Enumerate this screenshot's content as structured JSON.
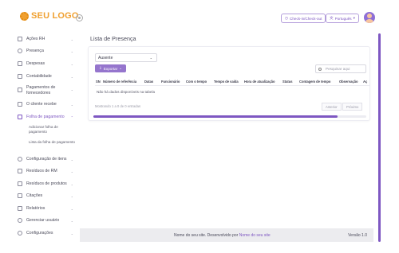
{
  "header": {
    "logo_text": "SEU LOGO",
    "checkin_label": "Check-in/Check-out",
    "language_label": "Português"
  },
  "sidebar": {
    "items": [
      {
        "label": "Ações RH"
      },
      {
        "label": "Presença"
      },
      {
        "label": "Despesas"
      },
      {
        "label": "Contabilidade"
      },
      {
        "label": "Pagamentos de fornecedores"
      },
      {
        "label": "O cliente recebe"
      },
      {
        "label": "Folha de pagamento"
      },
      {
        "label": "Configuração de itens"
      },
      {
        "label": "Resíduos de RM"
      },
      {
        "label": "Resíduos de produtos"
      },
      {
        "label": "Citações"
      },
      {
        "label": "Relatórios"
      },
      {
        "label": "Gerenciar usuário"
      },
      {
        "label": "Configurações"
      }
    ],
    "subitems": [
      {
        "label": "Adicionar folha de pagamento"
      },
      {
        "label": "Lista da folha de pagamento"
      }
    ]
  },
  "main": {
    "page_title": "Lista de Presença",
    "filter_value": "Ausente",
    "export_label": "Exportar",
    "search_placeholder": "Pesquisar aqui",
    "columns": [
      "SN",
      "Número de referência",
      "Datas",
      "Funcionário",
      "Com o tempo",
      "Tempo de saída",
      "Hora de atualização",
      "Status",
      "Contagem de tempo",
      "Observação",
      "Aç"
    ],
    "empty_message": "Não há dados disponíveis na tabela",
    "info_text": "Mostrando 1 a 0 de 0 entradas",
    "prev_label": "Anterior",
    "next_label": "Próximo"
  },
  "footer": {
    "text_before_link": "Nome do seu site. Desenvolvido por ",
    "link_text": "Nome do seu site",
    "version": "Versão 1.0"
  },
  "colors": {
    "accent": "#7e57c2",
    "logo": "#f0a030",
    "footer_bg": "#ececef"
  }
}
